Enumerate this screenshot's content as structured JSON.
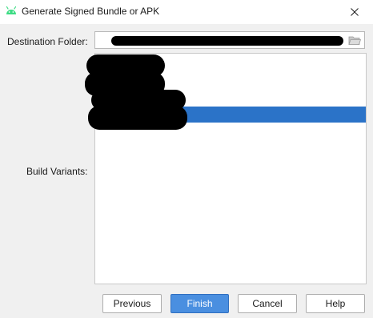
{
  "window": {
    "title": "Generate Signed Bundle or APK"
  },
  "form": {
    "destination_label": "Destination Folder:",
    "destination_value": "",
    "build_variants_label": "Build Variants:",
    "build_variants": [
      {
        "label": "",
        "selected": false
      },
      {
        "label": "",
        "selected": false
      },
      {
        "label": "",
        "selected": false
      },
      {
        "label": "",
        "selected": true
      }
    ]
  },
  "buttons": {
    "previous": "Previous",
    "finish": "Finish",
    "cancel": "Cancel",
    "help": "Help"
  },
  "icons": {
    "app": "android-icon",
    "close": "close-icon",
    "browse": "folder-icon"
  },
  "colors": {
    "selection": "#2b73c8",
    "primary_button": "#4a8fe0",
    "android_green": "#3ddc84"
  }
}
